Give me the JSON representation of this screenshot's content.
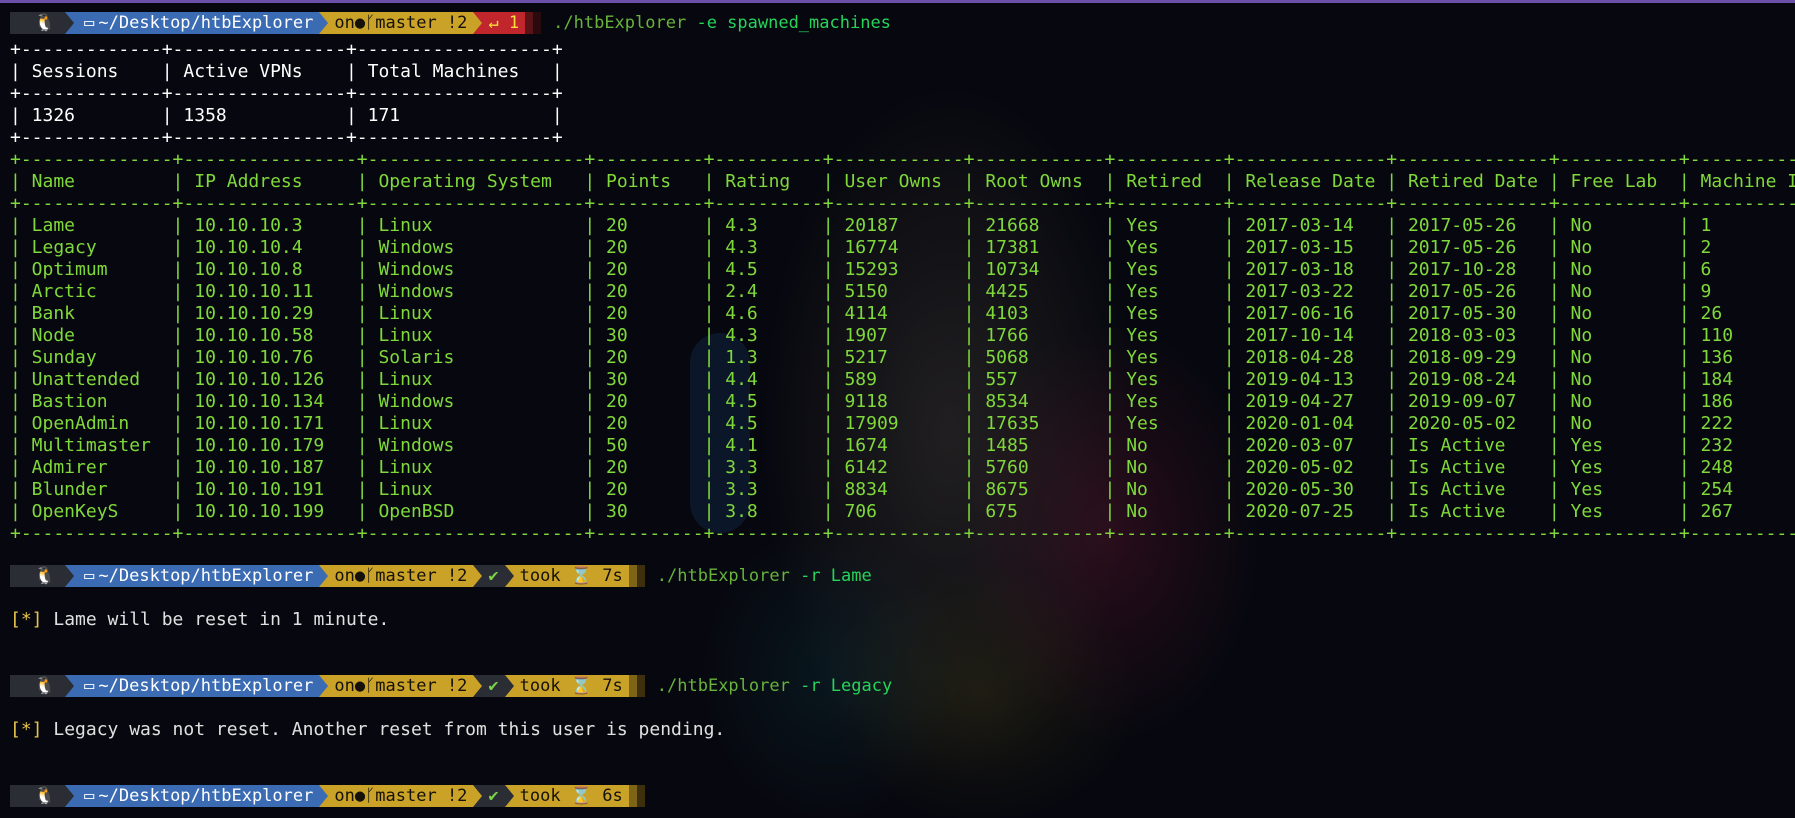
{
  "prompt": {
    "os_icon": "linux-tux-icon",
    "path": "~/Desktop/htbExplorer",
    "on": "on",
    "git_icon": "git-branch-icon",
    "branch": "master !2",
    "took": "took",
    "hourglass": "⌛"
  },
  "commands": [
    {
      "exe": "./htbExplorer",
      "args": "-e spawned_machines",
      "status": "↵ 1"
    },
    {
      "exe": "./htbExplorer",
      "args": "-r Lame",
      "took": "7s"
    },
    {
      "exe": "./htbExplorer",
      "args": "-r Legacy",
      "took": "7s"
    },
    {
      "took": "6s"
    }
  ],
  "summary_table": {
    "headers": [
      "Sessions",
      "Active VPNs",
      "Total Machines"
    ],
    "row": [
      "1326",
      "1358",
      "171"
    ]
  },
  "machines_table": {
    "headers": [
      "Name",
      "IP Address",
      "Operating System",
      "Points",
      "Rating",
      "User Owns",
      "Root Owns",
      "Retired",
      "Release Date",
      "Retired Date",
      "Free Lab",
      "Machine ID"
    ],
    "rows": [
      [
        "Lame",
        "10.10.10.3",
        "Linux",
        "20",
        "4.3",
        "20187",
        "21668",
        "Yes",
        "2017-03-14",
        "2017-05-26",
        "No",
        "1"
      ],
      [
        "Legacy",
        "10.10.10.4",
        "Windows",
        "20",
        "4.3",
        "16774",
        "17381",
        "Yes",
        "2017-03-15",
        "2017-05-26",
        "No",
        "2"
      ],
      [
        "Optimum",
        "10.10.10.8",
        "Windows",
        "20",
        "4.5",
        "15293",
        "10734",
        "Yes",
        "2017-03-18",
        "2017-10-28",
        "No",
        "6"
      ],
      [
        "Arctic",
        "10.10.10.11",
        "Windows",
        "20",
        "2.4",
        "5150",
        "4425",
        "Yes",
        "2017-03-22",
        "2017-05-26",
        "No",
        "9"
      ],
      [
        "Bank",
        "10.10.10.29",
        "Linux",
        "20",
        "4.6",
        "4114",
        "4103",
        "Yes",
        "2017-06-16",
        "2017-05-30",
        "No",
        "26"
      ],
      [
        "Node",
        "10.10.10.58",
        "Linux",
        "30",
        "4.3",
        "1907",
        "1766",
        "Yes",
        "2017-10-14",
        "2018-03-03",
        "No",
        "110"
      ],
      [
        "Sunday",
        "10.10.10.76",
        "Solaris",
        "20",
        "1.3",
        "5217",
        "5068",
        "Yes",
        "2018-04-28",
        "2018-09-29",
        "No",
        "136"
      ],
      [
        "Unattended",
        "10.10.10.126",
        "Linux",
        "30",
        "4.4",
        "589",
        "557",
        "Yes",
        "2019-04-13",
        "2019-08-24",
        "No",
        "184"
      ],
      [
        "Bastion",
        "10.10.10.134",
        "Windows",
        "20",
        "4.5",
        "9118",
        "8534",
        "Yes",
        "2019-04-27",
        "2019-09-07",
        "No",
        "186"
      ],
      [
        "OpenAdmin",
        "10.10.10.171",
        "Linux",
        "20",
        "4.5",
        "17909",
        "17635",
        "Yes",
        "2020-01-04",
        "2020-05-02",
        "No",
        "222"
      ],
      [
        "Multimaster",
        "10.10.10.179",
        "Windows",
        "50",
        "4.1",
        "1674",
        "1485",
        "No",
        "2020-03-07",
        "Is Active",
        "Yes",
        "232"
      ],
      [
        "Admirer",
        "10.10.10.187",
        "Linux",
        "20",
        "3.3",
        "6142",
        "5760",
        "No",
        "2020-05-02",
        "Is Active",
        "Yes",
        "248"
      ],
      [
        "Blunder",
        "10.10.10.191",
        "Linux",
        "20",
        "3.3",
        "8834",
        "8675",
        "No",
        "2020-05-30",
        "Is Active",
        "Yes",
        "254"
      ],
      [
        "OpenKeyS",
        "10.10.10.199",
        "OpenBSD",
        "30",
        "3.8",
        "706",
        "675",
        "No",
        "2020-07-25",
        "Is Active",
        "Yes",
        "267"
      ]
    ]
  },
  "messages": [
    {
      "marker": "[*]",
      "text": " Lame will be reset in 1 minute."
    },
    {
      "marker": "[*]",
      "text": " Legacy was not reset. Another reset from this user is pending."
    }
  ],
  "colors": {
    "background": "#07080f",
    "dir_segment": "#3a6bb3",
    "git_segment": "#c9a227",
    "error_segment": "#c0262b",
    "table_text": "#7fd93a"
  }
}
